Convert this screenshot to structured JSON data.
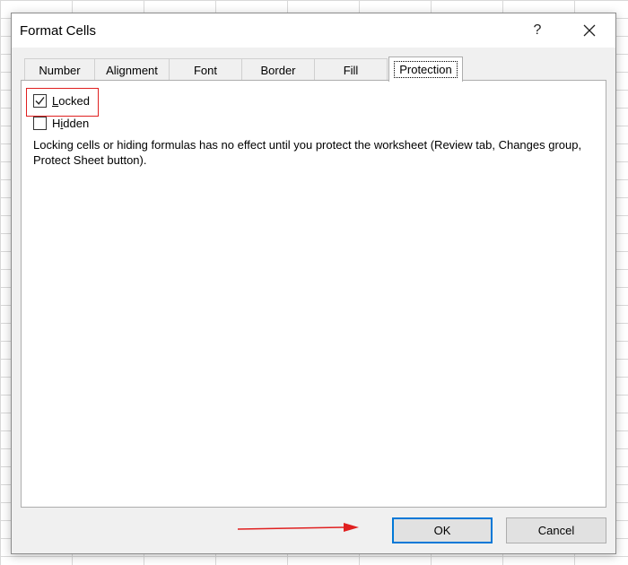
{
  "dialog": {
    "title": "Format Cells",
    "help_label": "?",
    "close_icon": "close-icon"
  },
  "tabs": [
    {
      "label": "Number",
      "active": false
    },
    {
      "label": "Alignment",
      "active": false
    },
    {
      "label": "Font",
      "active": false
    },
    {
      "label": "Border",
      "active": false
    },
    {
      "label": "Fill",
      "active": false
    },
    {
      "label": "Protection",
      "active": true
    }
  ],
  "protection": {
    "locked": {
      "label_accel": "L",
      "label_rest": "ocked",
      "checked": true
    },
    "hidden": {
      "label_pre": "H",
      "label_accel": "i",
      "label_rest": "dden",
      "checked": false
    },
    "note": "Locking cells or hiding formulas has no effect until you protect the worksheet (Review tab, Changes group, Protect Sheet button)."
  },
  "buttons": {
    "ok_label": "OK",
    "cancel_label": "Cancel"
  },
  "annotations": {
    "highlight_color": "#e02020",
    "arrow_color": "#e02020"
  },
  "colors": {
    "focus_border": "#0078d7",
    "dialog_bg": "#f0f0f0"
  }
}
